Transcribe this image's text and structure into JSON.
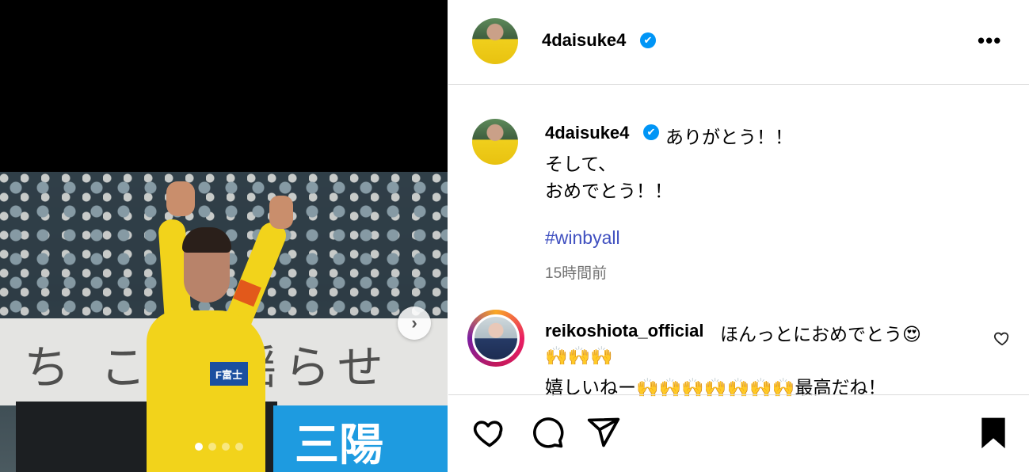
{
  "post": {
    "username": "4daisuke4",
    "verified_mark": "✔",
    "more_label": "•••",
    "caption_lines": [
      "ありがとう！！",
      "そして、",
      "おめでとう！！"
    ],
    "hashtag": "#winbyall",
    "timestamp": "15時間前"
  },
  "media": {
    "banner_text": "ち こ を揺らせ",
    "adboard_text": "三陽",
    "sponsor_text": "F富士",
    "next_glyph": "›",
    "slide_count": 4,
    "active_slide": 1
  },
  "comment": {
    "username": "reikoshiota_official",
    "line1": "ほんっとにおめでとう😍",
    "line2": "🙌🙌🙌",
    "line3": "嬉しいねー🙌🙌🙌🙌🙌🙌🙌最高だね！"
  },
  "actions": {
    "icons": [
      "heart-icon",
      "comment-icon",
      "share-icon",
      "bookmark-icon"
    ]
  },
  "colors": {
    "verified_blue": "#0095f6",
    "hashtag": "#4050c0",
    "timestamp_gray": "#737373",
    "jersey_yellow": "#f2d31b"
  }
}
